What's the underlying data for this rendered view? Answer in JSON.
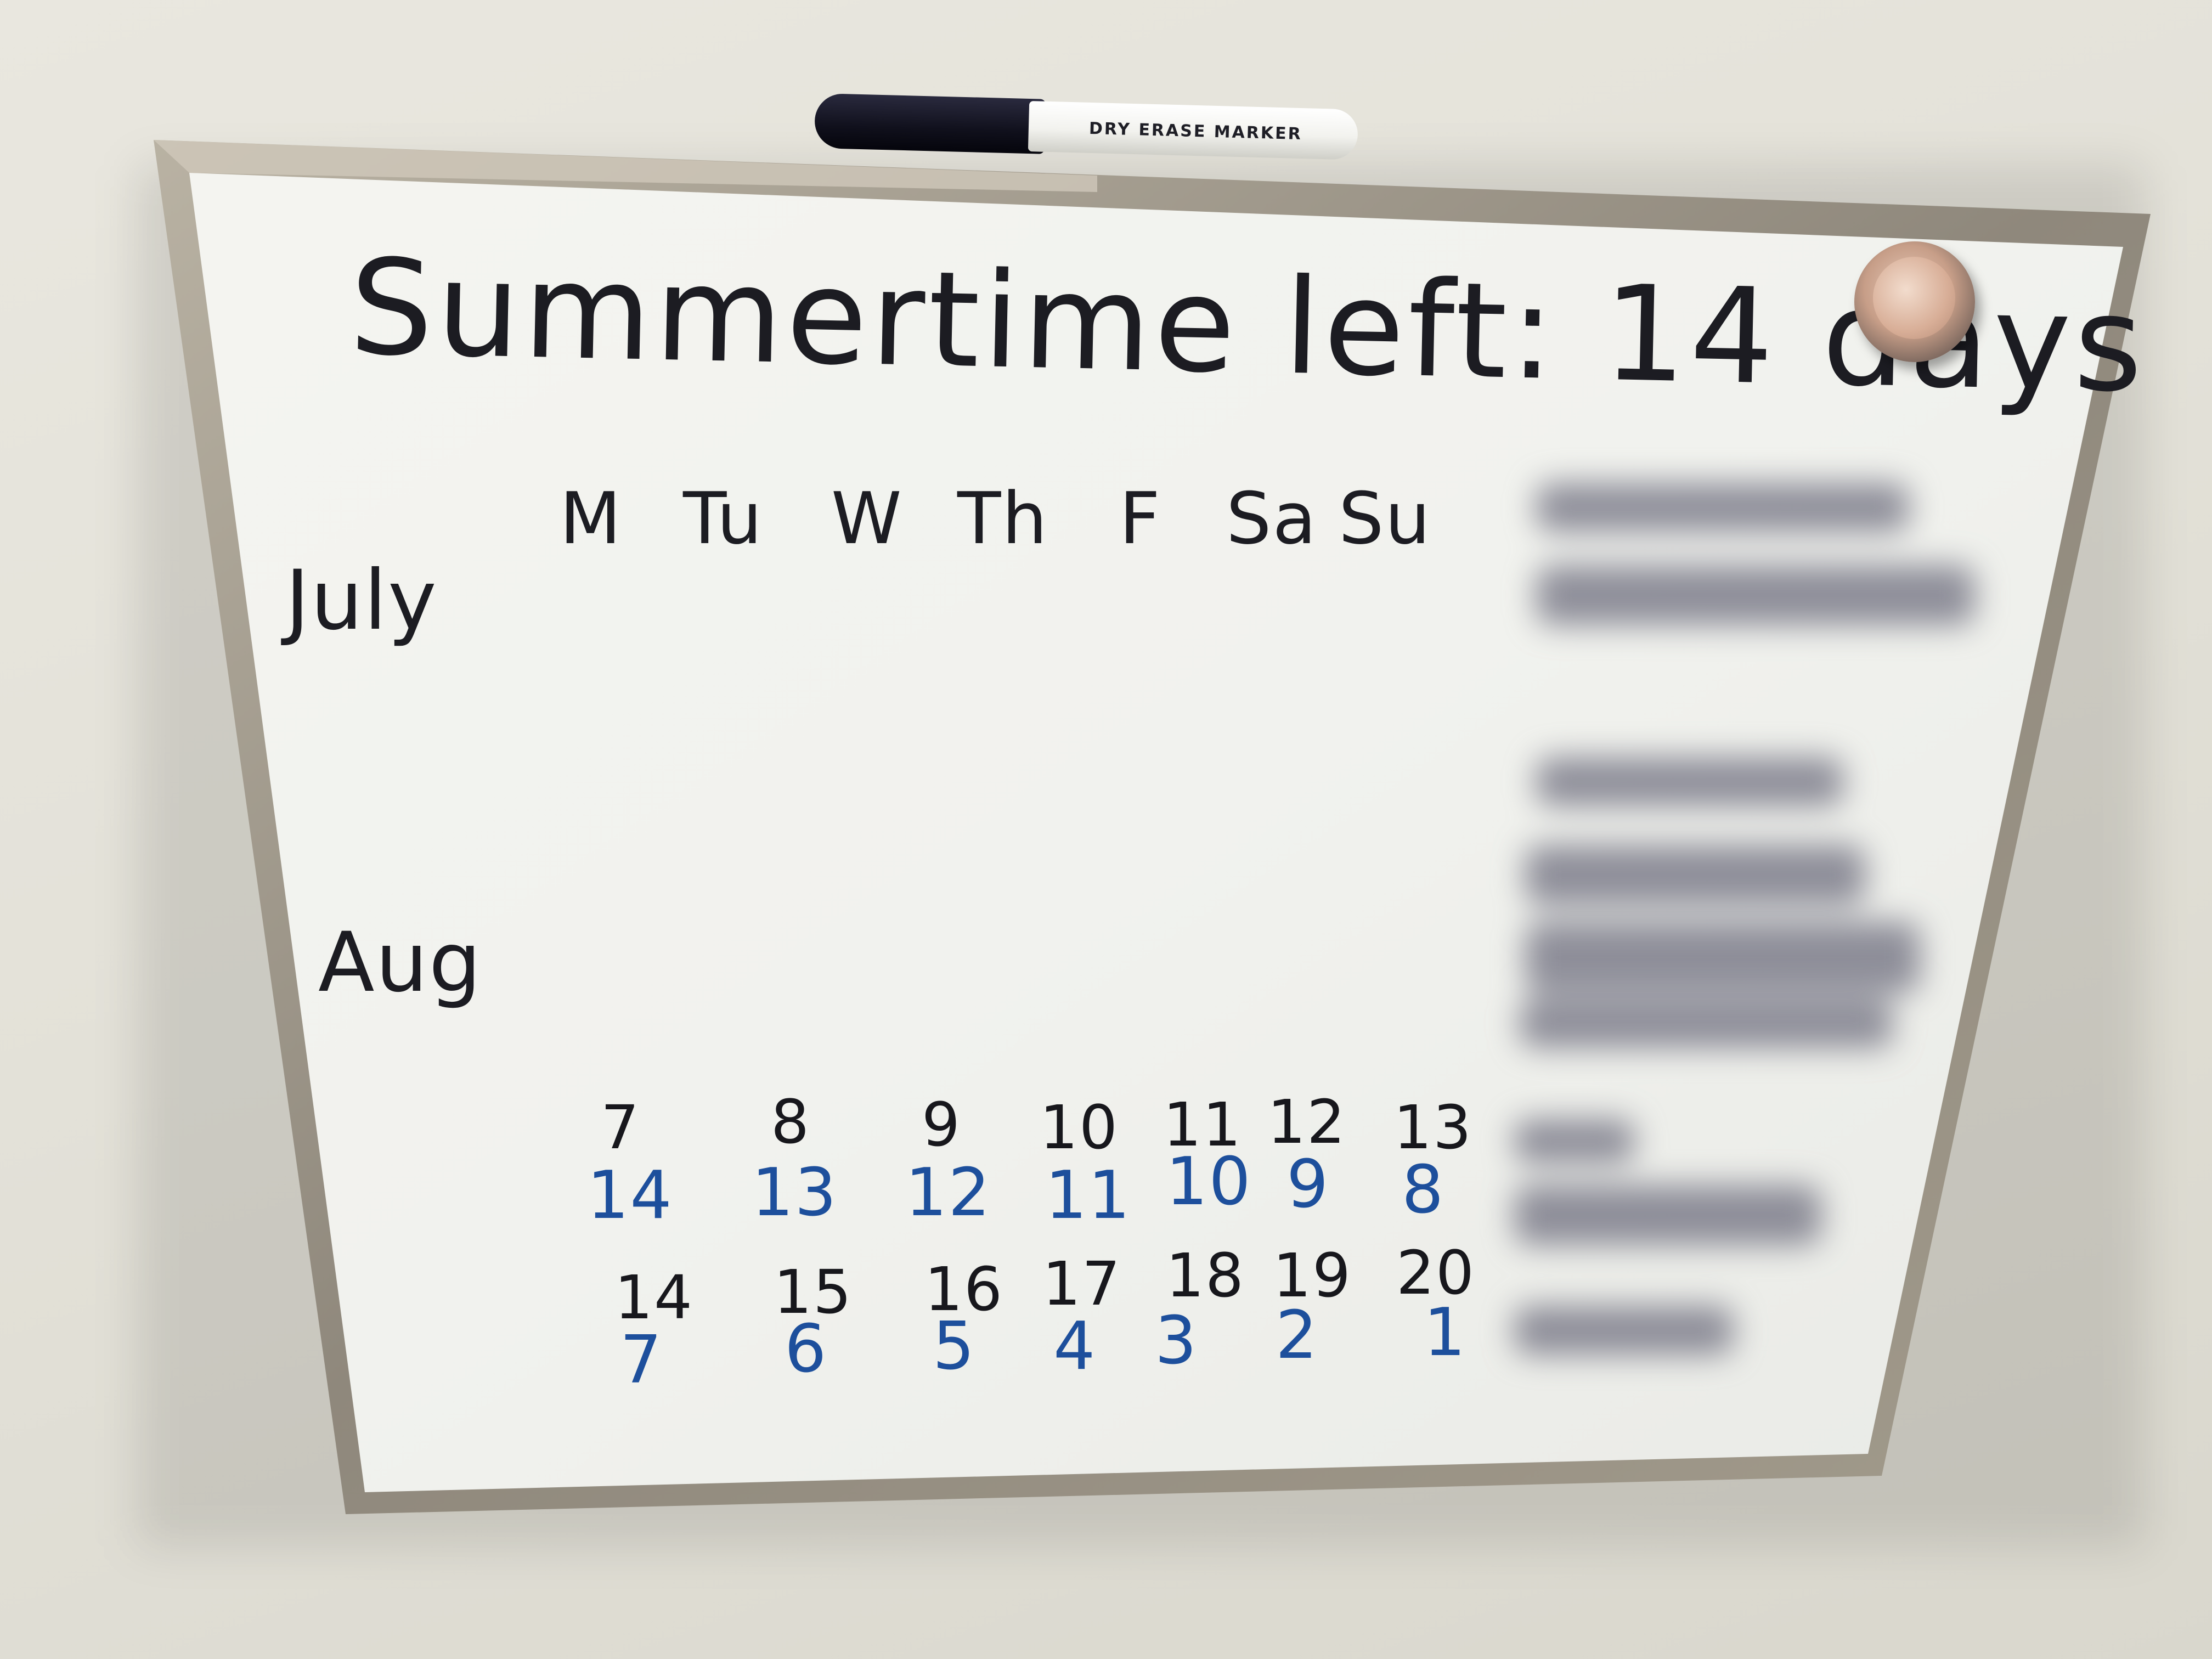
{
  "marker": {
    "label": "DRY ERASE MARKER"
  },
  "board": {
    "title": "Summertime left: 14 days",
    "weekdays": [
      "M",
      "Tu",
      "W",
      "Th",
      "F",
      "Sa",
      "Su"
    ],
    "months": [
      "July",
      "Aug"
    ],
    "weeks": [
      {
        "dates": [
          "7",
          "8",
          "9",
          "10",
          "11",
          "12",
          "13"
        ],
        "countdown": [
          "14",
          "13",
          "12",
          "11",
          "10",
          "9",
          "8"
        ]
      },
      {
        "dates": [
          "14",
          "15",
          "16",
          "17",
          "18",
          "19",
          "20"
        ],
        "countdown": [
          "7",
          "6",
          "5",
          "4",
          "3",
          "2",
          "1"
        ]
      }
    ],
    "ink_colors": {
      "black": "#1c1c22",
      "blue": "#1d4f9c"
    }
  },
  "redacted_region": true
}
